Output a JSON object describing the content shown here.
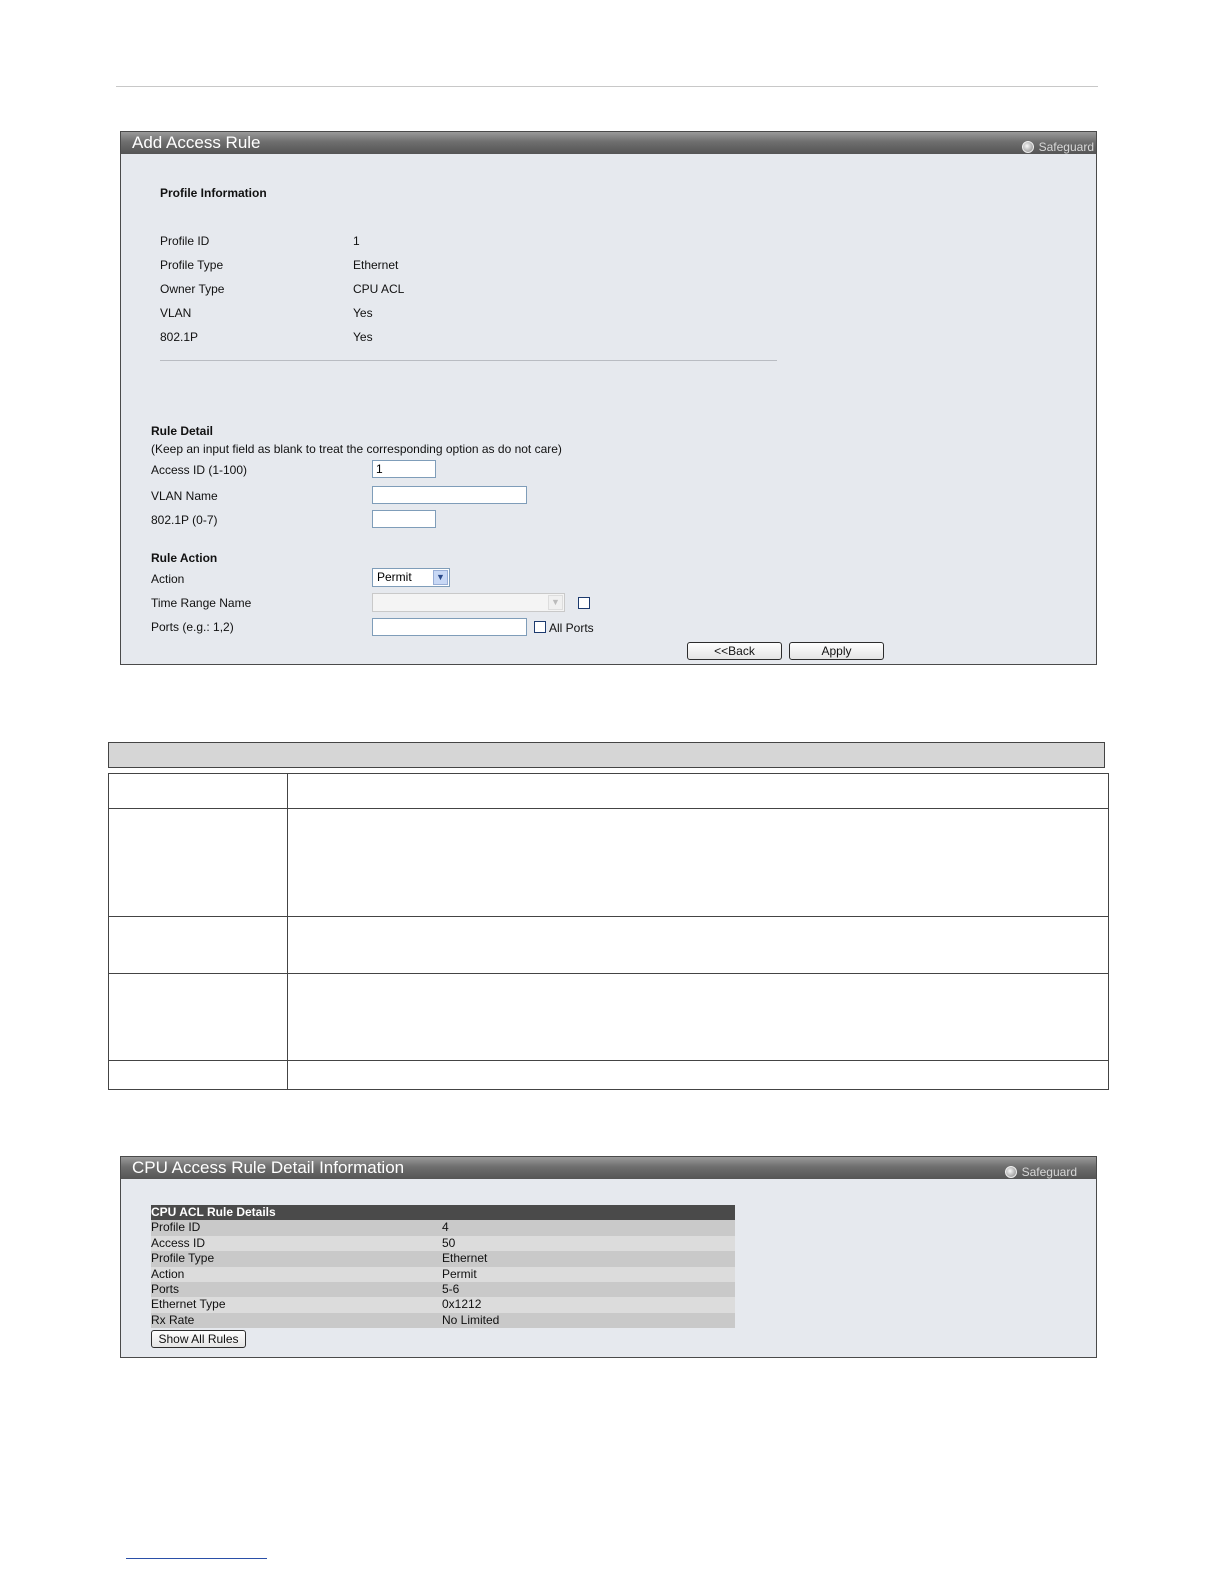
{
  "add_rule": {
    "title": "Add Access Rule",
    "safeguard": "Safeguard",
    "profile_info_heading": "Profile Information",
    "profile_fields": [
      {
        "label": "Profile ID",
        "value": "1"
      },
      {
        "label": "Profile Type",
        "value": "Ethernet"
      },
      {
        "label": "Owner Type",
        "value": "CPU ACL"
      },
      {
        "label": "VLAN",
        "value": "Yes"
      },
      {
        "label": "802.1P",
        "value": "Yes"
      }
    ],
    "rule_detail_heading": "Rule Detail",
    "rule_detail_note": "(Keep an input field as blank to treat the corresponding option as do not care)",
    "access_id_label": "Access ID (1-100)",
    "access_id_value": "1",
    "vlan_name_label": "VLAN Name",
    "vlan_name_value": "",
    "dot1p_label": "802.1P  (0-7)",
    "dot1p_value": "",
    "rule_action_heading": "Rule Action",
    "action_label": "Action",
    "action_value": "Permit",
    "time_range_label": "Time Range Name",
    "time_range_value": "",
    "ports_label": "Ports (e.g.: 1,2)",
    "ports_value": "",
    "all_ports_label": "All Ports",
    "back_button": "<<Back",
    "apply_button": "Apply"
  },
  "rule_details": {
    "title": "CPU Access Rule Detail Information",
    "safeguard": "Safeguard",
    "table_heading": "CPU ACL Rule Details",
    "rows": [
      {
        "key": "Profile  ID",
        "value": "4"
      },
      {
        "key": "Access ID",
        "value": "50"
      },
      {
        "key": "Profile Type",
        "value": "Ethernet"
      },
      {
        "key": "Action",
        "value": "Permit"
      },
      {
        "key": "Ports",
        "value": "5-6"
      },
      {
        "key": "Ethernet Type",
        "value": "0x1212"
      },
      {
        "key": "Rx Rate",
        "value": "No Limited"
      }
    ],
    "show_all_button": "Show All Rules"
  }
}
